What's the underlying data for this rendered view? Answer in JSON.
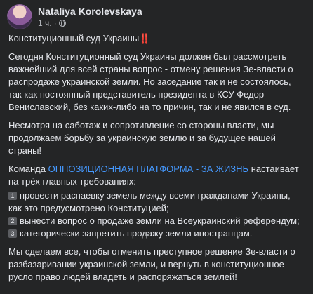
{
  "header": {
    "author": "Nataliya Korolevskaya",
    "time": "1 ч.",
    "dot": "·"
  },
  "post": {
    "title": "Конституционный суд Украины",
    "title_emoji": "‼️",
    "para1": "Сегодня Конституционный суд Украины должен был рассмотреть важнейший для всей страны вопрос - отмену решения Зе-власти о распродаже украинской земли. Но заседание так и не состоялось, так как постоянный представитель президента в КСУ Федор Вениславский, без каких-либо на то причин, так и не явился в суд.",
    "para2": "Несмотря на саботаж и сопротивление со стороны власти, мы продолжаем борьбу за украинскую землю и за будущее нашей страны!",
    "para3_before": "Команда ",
    "para3_link": "ОППОЗИЦИОННАЯ ПЛАТФОРМА - ЗА ЖИЗНЬ",
    "para3_after": " настаивает на трёх главных требованиях:",
    "req1_num": "1",
    "req1": "провести распаевку земель между всеми гражданами Украины, как это предусмотрено Конституцией;",
    "req2_num": "2",
    "req2": "вынести вопрос о продаже земли на Всеукраинский референдум;",
    "req3_num": "3",
    "req3": "категорически запретить продажу земли иностранцам.",
    "para4": "Мы сделаем все, чтобы отменить преступное решение Зе-власти о разбазаривании украинской земли, и вернуть в конституционное русло право людей владеть и распоряжаться землей!"
  }
}
